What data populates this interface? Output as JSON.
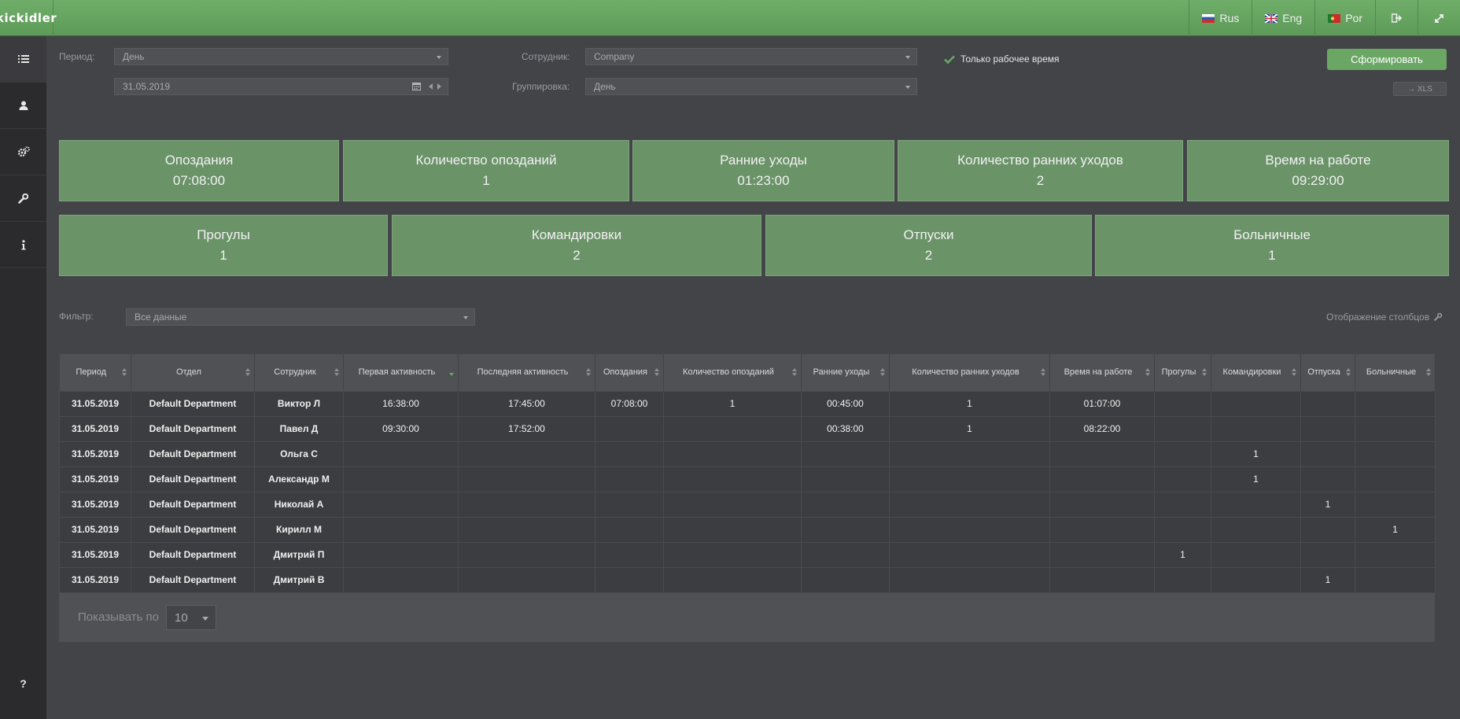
{
  "app": {
    "logo": "кіckidler"
  },
  "topnav": {
    "rus": "Rus",
    "eng": "Eng",
    "por": "Por"
  },
  "filters": {
    "period_label": "Период:",
    "period_value": "День",
    "date_value": "31.05.2019",
    "employee_label": "Сотрудник:",
    "employee_value": "Company",
    "grouping_label": "Группировка:",
    "grouping_value": "День",
    "working_only_label": "Только рабочее время",
    "generate_button": "Сформировать",
    "xls_button": "→ XLS"
  },
  "cards_row1": [
    {
      "title": "Опоздания",
      "value": "07:08:00"
    },
    {
      "title": "Количество опозданий",
      "value": "1"
    },
    {
      "title": "Ранние уходы",
      "value": "01:23:00"
    },
    {
      "title": "Количество ранних уходов",
      "value": "2"
    },
    {
      "title": "Время на работе",
      "value": "09:29:00"
    }
  ],
  "cards_row2": [
    {
      "title": "Прогулы",
      "value": "1"
    },
    {
      "title": "Командировки",
      "value": "2"
    },
    {
      "title": "Отпуски",
      "value": "2"
    },
    {
      "title": "Больничные",
      "value": "1"
    }
  ],
  "data_filter": {
    "label": "Фильтр:",
    "value": "Все данные",
    "columns_link": "Отображение столбцов"
  },
  "table": {
    "columns": [
      "Период",
      "Отдел",
      "Сотрудник",
      "Первая активность",
      "Последняя активность",
      "Опоздания",
      "Количество опозданий",
      "Ранние уходы",
      "Количество ранних уходов",
      "Время на работе",
      "Прогулы",
      "Командировки",
      "Отпуска",
      "Больничные"
    ],
    "rows": [
      [
        "31.05.2019",
        "Default Department",
        "Виктор Л",
        "16:38:00",
        "17:45:00",
        "07:08:00",
        "1",
        "00:45:00",
        "1",
        "01:07:00",
        "",
        "",
        "",
        ""
      ],
      [
        "31.05.2019",
        "Default Department",
        "Павел Д",
        "09:30:00",
        "17:52:00",
        "",
        "",
        "00:38:00",
        "1",
        "08:22:00",
        "",
        "",
        "",
        ""
      ],
      [
        "31.05.2019",
        "Default Department",
        "Ольга С",
        "",
        "",
        "",
        "",
        "",
        "",
        "",
        "",
        "1",
        "",
        ""
      ],
      [
        "31.05.2019",
        "Default Department",
        "Александр М",
        "",
        "",
        "",
        "",
        "",
        "",
        "",
        "",
        "1",
        "",
        ""
      ],
      [
        "31.05.2019",
        "Default Department",
        "Николай А",
        "",
        "",
        "",
        "",
        "",
        "",
        "",
        "",
        "",
        "1",
        ""
      ],
      [
        "31.05.2019",
        "Default Department",
        "Кирилл М",
        "",
        "",
        "",
        "",
        "",
        "",
        "",
        "",
        "",
        "",
        "1"
      ],
      [
        "31.05.2019",
        "Default Department",
        "Дмитрий П",
        "",
        "",
        "",
        "",
        "",
        "",
        "",
        "1",
        "",
        "",
        ""
      ],
      [
        "31.05.2019",
        "Default Department",
        "Дмитрий В",
        "",
        "",
        "",
        "",
        "",
        "",
        "",
        "",
        "",
        "1",
        ""
      ]
    ]
  },
  "pager": {
    "label": "Показывать по",
    "page_size": "10"
  },
  "sidebar": {
    "help": "?"
  }
}
